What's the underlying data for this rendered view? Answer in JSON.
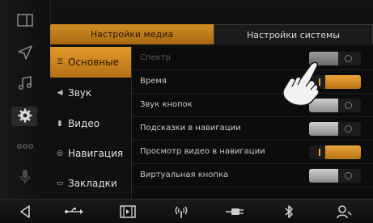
{
  "tabs": {
    "media": "Настройки медиа",
    "system": "Настройки системы"
  },
  "categories": [
    {
      "label": "Основные",
      "icon": "list-icon",
      "active": true
    },
    {
      "label": "Звук",
      "icon": "speaker-icon",
      "active": false
    },
    {
      "label": "Видео",
      "icon": "film-icon",
      "active": false
    },
    {
      "label": "Навигация",
      "icon": "compass-icon",
      "active": false
    },
    {
      "label": "Закладки",
      "icon": "bookmark-icon",
      "active": false
    }
  ],
  "settings": [
    {
      "label": "Спектр",
      "state": "off",
      "dim": true
    },
    {
      "label": "Время",
      "state": "on",
      "dim": false
    },
    {
      "label": "Звук кнопок",
      "state": "off",
      "dim": false
    },
    {
      "label": "Подсказки в навигации",
      "state": "off",
      "dim": false
    },
    {
      "label": "Просмотр видео в навигации",
      "state": "on",
      "dim": false
    },
    {
      "label": "Виртуальная кнопка",
      "state": "off",
      "dim": false
    }
  ],
  "rail_icons": [
    "split-screen-icon",
    "navigation-arrow-icon",
    "music-icon",
    "settings-gear-icon",
    "more-dots-icon",
    "microphone-icon",
    "back-icon"
  ],
  "bottom_icons": [
    "usb-icon",
    "video-icon",
    "radio-icon",
    "aux-plug-icon",
    "bluetooth-icon",
    "phone-link-icon"
  ],
  "colors": {
    "accent": "#d38f24",
    "background": "#0c0c0c",
    "text": "#c9c9c9"
  }
}
